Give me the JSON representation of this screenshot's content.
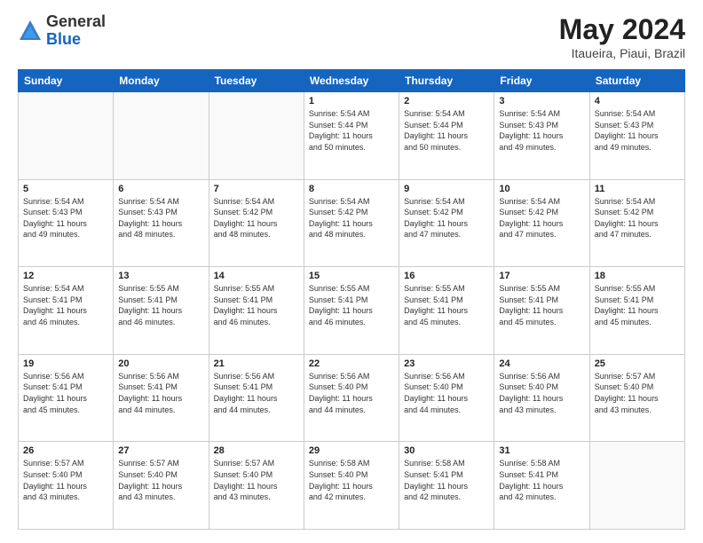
{
  "header": {
    "logo": {
      "general": "General",
      "blue": "Blue"
    },
    "title": "May 2024",
    "location": "Itaueira, Piaui, Brazil"
  },
  "weekdays": [
    "Sunday",
    "Monday",
    "Tuesday",
    "Wednesday",
    "Thursday",
    "Friday",
    "Saturday"
  ],
  "weeks": [
    [
      {
        "day": "",
        "info": ""
      },
      {
        "day": "",
        "info": ""
      },
      {
        "day": "",
        "info": ""
      },
      {
        "day": "1",
        "info": "Sunrise: 5:54 AM\nSunset: 5:44 PM\nDaylight: 11 hours\nand 50 minutes."
      },
      {
        "day": "2",
        "info": "Sunrise: 5:54 AM\nSunset: 5:44 PM\nDaylight: 11 hours\nand 50 minutes."
      },
      {
        "day": "3",
        "info": "Sunrise: 5:54 AM\nSunset: 5:43 PM\nDaylight: 11 hours\nand 49 minutes."
      },
      {
        "day": "4",
        "info": "Sunrise: 5:54 AM\nSunset: 5:43 PM\nDaylight: 11 hours\nand 49 minutes."
      }
    ],
    [
      {
        "day": "5",
        "info": "Sunrise: 5:54 AM\nSunset: 5:43 PM\nDaylight: 11 hours\nand 49 minutes."
      },
      {
        "day": "6",
        "info": "Sunrise: 5:54 AM\nSunset: 5:43 PM\nDaylight: 11 hours\nand 48 minutes."
      },
      {
        "day": "7",
        "info": "Sunrise: 5:54 AM\nSunset: 5:42 PM\nDaylight: 11 hours\nand 48 minutes."
      },
      {
        "day": "8",
        "info": "Sunrise: 5:54 AM\nSunset: 5:42 PM\nDaylight: 11 hours\nand 48 minutes."
      },
      {
        "day": "9",
        "info": "Sunrise: 5:54 AM\nSunset: 5:42 PM\nDaylight: 11 hours\nand 47 minutes."
      },
      {
        "day": "10",
        "info": "Sunrise: 5:54 AM\nSunset: 5:42 PM\nDaylight: 11 hours\nand 47 minutes."
      },
      {
        "day": "11",
        "info": "Sunrise: 5:54 AM\nSunset: 5:42 PM\nDaylight: 11 hours\nand 47 minutes."
      }
    ],
    [
      {
        "day": "12",
        "info": "Sunrise: 5:54 AM\nSunset: 5:41 PM\nDaylight: 11 hours\nand 46 minutes."
      },
      {
        "day": "13",
        "info": "Sunrise: 5:55 AM\nSunset: 5:41 PM\nDaylight: 11 hours\nand 46 minutes."
      },
      {
        "day": "14",
        "info": "Sunrise: 5:55 AM\nSunset: 5:41 PM\nDaylight: 11 hours\nand 46 minutes."
      },
      {
        "day": "15",
        "info": "Sunrise: 5:55 AM\nSunset: 5:41 PM\nDaylight: 11 hours\nand 46 minutes."
      },
      {
        "day": "16",
        "info": "Sunrise: 5:55 AM\nSunset: 5:41 PM\nDaylight: 11 hours\nand 45 minutes."
      },
      {
        "day": "17",
        "info": "Sunrise: 5:55 AM\nSunset: 5:41 PM\nDaylight: 11 hours\nand 45 minutes."
      },
      {
        "day": "18",
        "info": "Sunrise: 5:55 AM\nSunset: 5:41 PM\nDaylight: 11 hours\nand 45 minutes."
      }
    ],
    [
      {
        "day": "19",
        "info": "Sunrise: 5:56 AM\nSunset: 5:41 PM\nDaylight: 11 hours\nand 45 minutes."
      },
      {
        "day": "20",
        "info": "Sunrise: 5:56 AM\nSunset: 5:41 PM\nDaylight: 11 hours\nand 44 minutes."
      },
      {
        "day": "21",
        "info": "Sunrise: 5:56 AM\nSunset: 5:41 PM\nDaylight: 11 hours\nand 44 minutes."
      },
      {
        "day": "22",
        "info": "Sunrise: 5:56 AM\nSunset: 5:40 PM\nDaylight: 11 hours\nand 44 minutes."
      },
      {
        "day": "23",
        "info": "Sunrise: 5:56 AM\nSunset: 5:40 PM\nDaylight: 11 hours\nand 44 minutes."
      },
      {
        "day": "24",
        "info": "Sunrise: 5:56 AM\nSunset: 5:40 PM\nDaylight: 11 hours\nand 43 minutes."
      },
      {
        "day": "25",
        "info": "Sunrise: 5:57 AM\nSunset: 5:40 PM\nDaylight: 11 hours\nand 43 minutes."
      }
    ],
    [
      {
        "day": "26",
        "info": "Sunrise: 5:57 AM\nSunset: 5:40 PM\nDaylight: 11 hours\nand 43 minutes."
      },
      {
        "day": "27",
        "info": "Sunrise: 5:57 AM\nSunset: 5:40 PM\nDaylight: 11 hours\nand 43 minutes."
      },
      {
        "day": "28",
        "info": "Sunrise: 5:57 AM\nSunset: 5:40 PM\nDaylight: 11 hours\nand 43 minutes."
      },
      {
        "day": "29",
        "info": "Sunrise: 5:58 AM\nSunset: 5:40 PM\nDaylight: 11 hours\nand 42 minutes."
      },
      {
        "day": "30",
        "info": "Sunrise: 5:58 AM\nSunset: 5:41 PM\nDaylight: 11 hours\nand 42 minutes."
      },
      {
        "day": "31",
        "info": "Sunrise: 5:58 AM\nSunset: 5:41 PM\nDaylight: 11 hours\nand 42 minutes."
      },
      {
        "day": "",
        "info": ""
      }
    ]
  ]
}
